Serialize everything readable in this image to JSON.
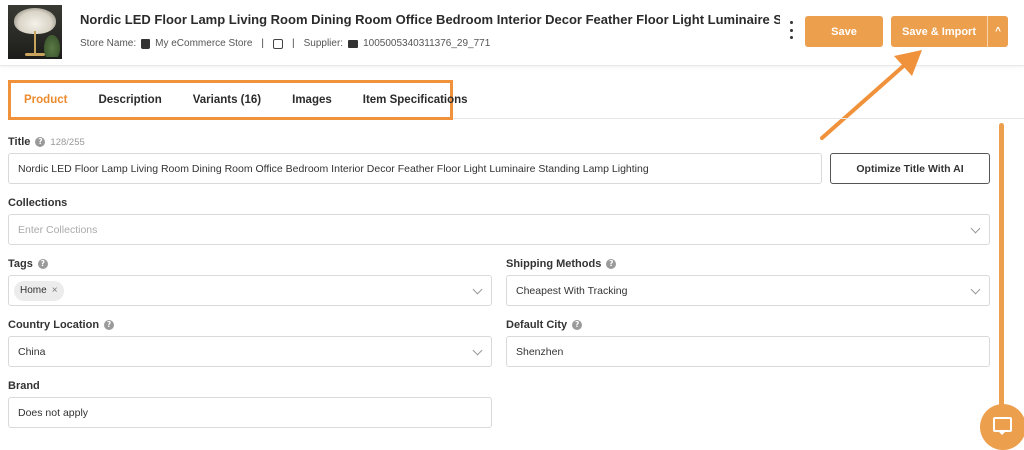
{
  "header": {
    "product_title": "Nordic LED Floor Lamp Living Room Dining Room Office Bedroom Interior Decor Feather Floor Light Luminaire Standing Lam...",
    "store_label": "Store Name:",
    "store_name": "My eCommerce Store",
    "supplier_label": "Supplier:",
    "supplier_id": "1005005340311376_29_771",
    "save_label": "Save",
    "save_import_label": "Save & Import",
    "caret": "^"
  },
  "tabs": [
    {
      "label": "Product",
      "active": true
    },
    {
      "label": "Description",
      "active": false
    },
    {
      "label": "Variants (16)",
      "active": false
    },
    {
      "label": "Images",
      "active": false
    },
    {
      "label": "Item Specifications",
      "active": false
    }
  ],
  "form": {
    "title": {
      "label": "Title",
      "counter": "128/255",
      "value": "Nordic LED Floor Lamp Living Room Dining Room Office Bedroom Interior Decor Feather Floor Light Luminaire Standing Lamp Lighting",
      "optimize_label": "Optimize Title With AI"
    },
    "collections": {
      "label": "Collections",
      "placeholder": "Enter Collections"
    },
    "tags": {
      "label": "Tags",
      "chips": [
        "Home"
      ]
    },
    "shipping": {
      "label": "Shipping Methods",
      "value": "Cheapest With Tracking"
    },
    "country": {
      "label": "Country Location",
      "value": "China"
    },
    "city": {
      "label": "Default City",
      "value": "Shenzhen"
    },
    "brand": {
      "label": "Brand",
      "value": "Does not apply"
    }
  },
  "help_glyph": "?",
  "remove_glyph": "×",
  "colors": {
    "accent": "#ec9f4c",
    "active_tab": "#ec8a2c",
    "highlight_border": "#f0923b"
  },
  "icons": [
    "shopping-bag-icon",
    "note-icon",
    "mail-icon",
    "more-vertical-icon",
    "chevron-down-icon",
    "help-icon",
    "chat-icon"
  ]
}
